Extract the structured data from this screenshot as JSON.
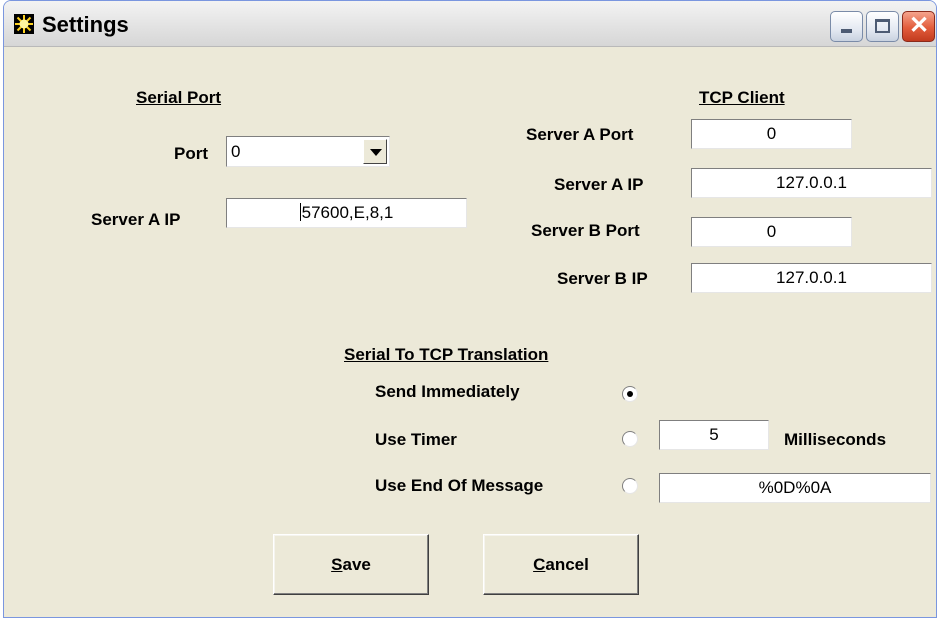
{
  "window": {
    "title": "Settings",
    "icon": "sun-app-icon",
    "controls": [
      "minimize-icon",
      "maximize-icon",
      "close-icon"
    ],
    "close_glyph": "✕"
  },
  "serial_port": {
    "heading": "Serial Port",
    "port_label": "Port",
    "port_value": "0",
    "server_a_ip_label": "Server A IP",
    "server_a_ip_value": "57600,E,8,1"
  },
  "tcp_client": {
    "heading": "TCP Client",
    "server_a_port_label": "Server A Port",
    "server_a_port_value": "0",
    "server_a_ip_label": "Server A IP",
    "server_a_ip_value": "127.0.0.1",
    "server_b_port_label": "Server B Port",
    "server_b_port_value": "0",
    "server_b_ip_label": "Server B IP",
    "server_b_ip_value": "127.0.0.1"
  },
  "translation": {
    "heading": "Serial To TCP Translation",
    "send_immediately_label": "Send Immediately",
    "send_immediately_selected": true,
    "use_timer_label": "Use Timer",
    "use_timer_selected": false,
    "timer_value": "5",
    "timer_unit": "Milliseconds",
    "use_eom_label": "Use End Of Message",
    "use_eom_selected": false,
    "eom_value": "%0D%0A"
  },
  "buttons": {
    "save_mnemonic": "S",
    "save_rest": "ave",
    "cancel_mnemonic": "C",
    "cancel_rest": "ancel"
  },
  "colors": {
    "dialog_bg": "#ece9d8",
    "close_button": "#e25c3b"
  }
}
